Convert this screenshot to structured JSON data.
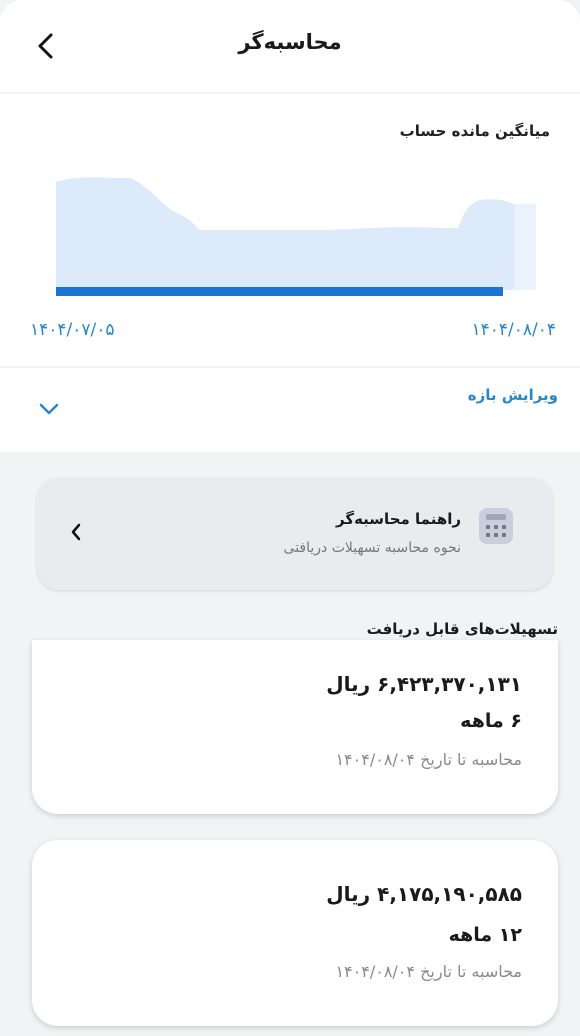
{
  "header": {
    "title": "محاسبه‌گر",
    "back_icon": "chevron-left-icon"
  },
  "chart": {
    "title": "میانگین مانده حساب",
    "start_label": "۱۴۰۴/۰۷/۰۵",
    "end_label": "۱۴۰۴/۰۸/۰۴",
    "area_color": "#ddeafa",
    "bar_color": "#1b73d3",
    "label_color": "#2a86c9"
  },
  "range": {
    "label": "ویرایش بازه",
    "icon": "chevron-down-icon"
  },
  "guide": {
    "title": "راهنما محاسبه‌گر",
    "subtitle": "نحوه محاسبه تسهیلات دریافتی",
    "icon": "calculator-icon"
  },
  "loans": {
    "title": "تسهیلات‌های قابل دریافت",
    "items": [
      {
        "amount": "۶,۴۲۳,۳۷۰,۱۳۱ ریال",
        "term": "۶ ماهه",
        "date": "محاسبه تا تاریخ ۱۴۰۴/۰۸/۰۴"
      },
      {
        "amount": "۴,۱۷۵,۱۹۰,۵۸۵ ریال",
        "term": "۱۲ ماهه",
        "date": "محاسبه تا تاریخ ۱۴۰۴/۰۸/۰۴"
      }
    ]
  }
}
